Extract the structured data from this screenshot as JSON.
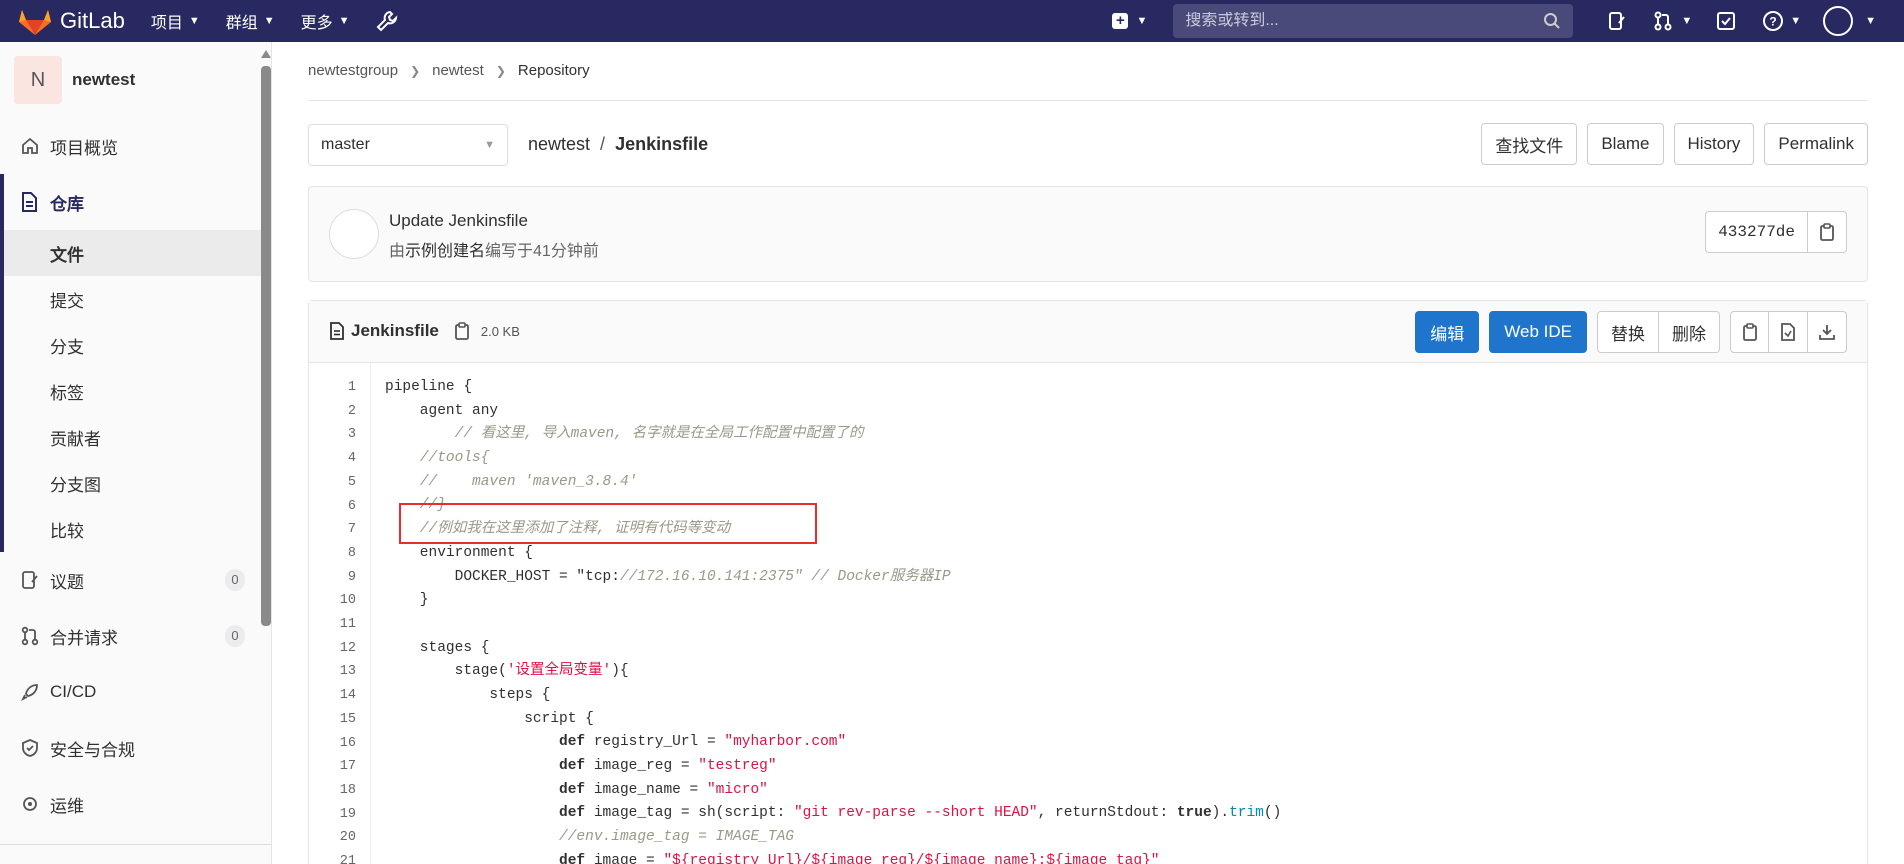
{
  "topbar": {
    "logo_text": "GitLab",
    "nav": [
      {
        "label": "项目"
      },
      {
        "label": "群组"
      },
      {
        "label": "更多"
      }
    ],
    "search_placeholder": "搜索或转到..."
  },
  "sidebar": {
    "project_initial": "N",
    "project_name": "newtest",
    "overview": "项目概览",
    "repository": "仓库",
    "repo_sub": [
      "文件",
      "提交",
      "分支",
      "标签",
      "贡献者",
      "分支图",
      "比较"
    ],
    "issues": {
      "label": "议题",
      "count": "0"
    },
    "merge_requests": {
      "label": "合并请求",
      "count": "0"
    },
    "cicd": "CI/CD",
    "security": "安全与合规",
    "operations": "运维"
  },
  "breadcrumb": [
    "newtestgroup",
    "newtest",
    "Repository"
  ],
  "branch": "master",
  "path": {
    "project": "newtest",
    "file": "Jenkinsfile"
  },
  "file_actions": [
    "查找文件",
    "Blame",
    "History",
    "Permalink"
  ],
  "commit": {
    "title": "Update Jenkinsfile",
    "by": "由",
    "author": "示例创建名",
    "time": "编写于41分钟前",
    "sha": "433277de"
  },
  "file": {
    "name": "Jenkinsfile",
    "size": "2.0 KB",
    "edit_label": "编辑",
    "webide_label": "Web IDE",
    "replace_label": "替换",
    "delete_label": "删除"
  },
  "code_lines": [
    "pipeline {",
    "    agent any",
    "        // 看这里, 导入maven, 名字就是在全局工作配置中配置了的",
    "    //tools{",
    "    //    maven 'maven_3.8.4'",
    "    //}",
    "    //例如我在这里添加了注释, 证明有代码等变动",
    "    environment {",
    "        DOCKER_HOST = \"tcp://172.16.10.141:2375\" // Docker服务器IP",
    "    }",
    "",
    "    stages {",
    "        stage('设置全局变量'){",
    "            steps {",
    "                script {",
    "                    def registry_Url = \"myharbor.com\"",
    "                    def image_reg = \"testreg\"",
    "                    def image_name = \"micro\"",
    "                    def image_tag = sh(script: \"git rev-parse --short HEAD\", returnStdout: true).trim()",
    "                    //env.image_tag = IMAGE_TAG",
    "                    def image = \"${registry_Url}/${image_reg}/${image_name}:${image_tag}\""
  ],
  "colors": {
    "nav_bg": "#292961",
    "primary_blue": "#1f75cb",
    "highlight_red": "#e62e2e"
  }
}
